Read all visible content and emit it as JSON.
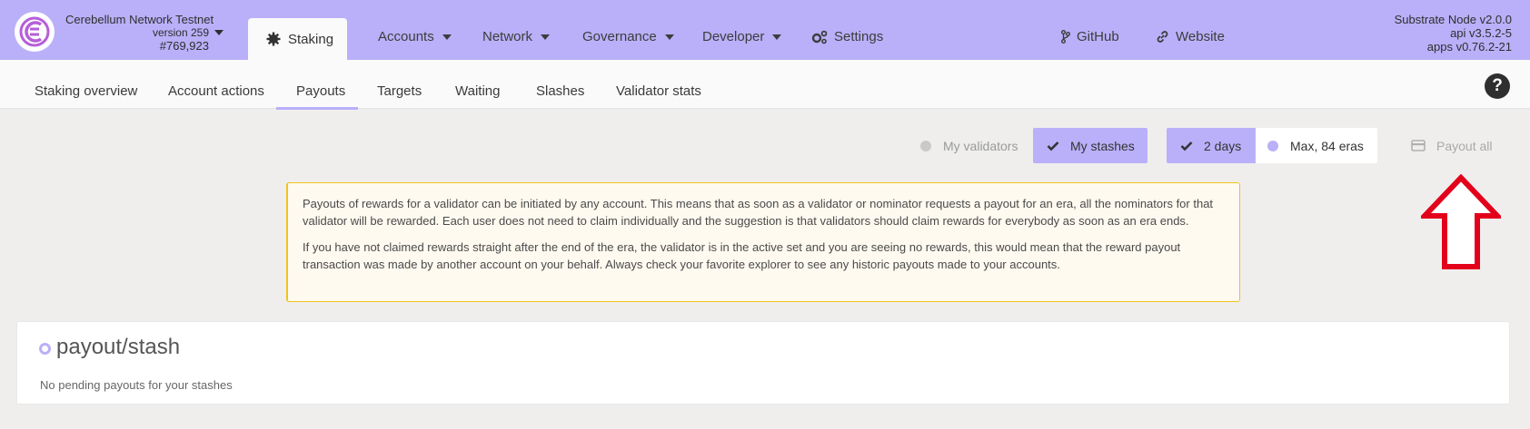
{
  "header": {
    "chain_name": "Cerebellum Network Testnet",
    "version": "version 259",
    "block": "#769,923",
    "active_tab": "Staking",
    "menu": [
      {
        "label": "Accounts",
        "icon": "chevron-down-icon"
      },
      {
        "label": "Network",
        "icon": "chevron-down-icon"
      },
      {
        "label": "Governance",
        "icon": "chevron-down-icon"
      },
      {
        "label": "Developer",
        "icon": "chevron-down-icon"
      },
      {
        "label": "Settings",
        "icon": "gears-icon"
      }
    ],
    "links": [
      {
        "label": "GitHub",
        "icon": "code-branch-icon"
      },
      {
        "label": "Website",
        "icon": "link-icon"
      }
    ],
    "node": {
      "substrate": "Substrate Node v2.0.0",
      "api": "api v3.5.2-5",
      "apps": "apps v0.76.2-21"
    }
  },
  "subnav": {
    "tabs": [
      "Staking overview",
      "Account actions",
      "Payouts",
      "Targets",
      "Waiting",
      "Slashes",
      "Validator stats"
    ],
    "active": "Payouts",
    "help": "?"
  },
  "controls": {
    "my_validators": "My validators",
    "my_stashes": "My stashes",
    "days": "2 days",
    "max_eras": "Max, 84 eras",
    "payout_all": "Payout all"
  },
  "info": {
    "p1": "Payouts of rewards for a validator can be initiated by any account. This means that as soon as a validator or nominator requests a payout for an era, all the nominators for that validator will be rewarded. Each user does not need to claim individually and the suggestion is that validators should claim rewards for everybody as soon as an era ends.",
    "p2": "If you have not claimed rewards straight after the end of the era, the validator is in the active set and you are seeing no rewards, this would mean that the reward payout transaction was made by another account on your behalf. Always check your favorite explorer to see any historic payouts made to your accounts."
  },
  "payouts": {
    "title": "payout/stash",
    "empty": "No pending payouts for your stashes"
  },
  "colors": {
    "accent": "#b9b0f9",
    "warning_border": "#f0c419",
    "arrow": "#e3001b"
  }
}
